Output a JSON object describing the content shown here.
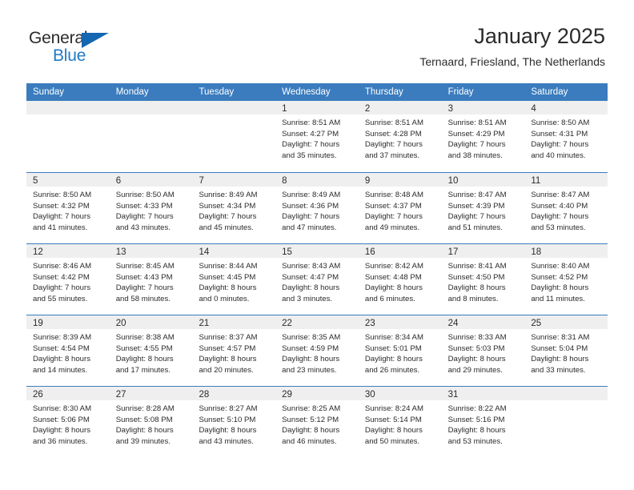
{
  "logo": {
    "word_top": "General",
    "word_bottom": "Blue",
    "triangle_color": "#1567b1",
    "blue_color": "#1f7ac4"
  },
  "header": {
    "title": "January 2025",
    "subtitle": "Ternaard, Friesland, The Netherlands"
  },
  "theme": {
    "header_blue": "#3a7cbe",
    "daynum_band": "#efefef",
    "text": "#2b2b2b"
  },
  "calendar": {
    "day_names": [
      "Sunday",
      "Monday",
      "Tuesday",
      "Wednesday",
      "Thursday",
      "Friday",
      "Saturday"
    ],
    "weeks": [
      [
        {
          "day": "",
          "lines": []
        },
        {
          "day": "",
          "lines": []
        },
        {
          "day": "",
          "lines": []
        },
        {
          "day": "1",
          "lines": [
            "Sunrise: 8:51 AM",
            "Sunset: 4:27 PM",
            "Daylight: 7 hours",
            "and 35 minutes."
          ]
        },
        {
          "day": "2",
          "lines": [
            "Sunrise: 8:51 AM",
            "Sunset: 4:28 PM",
            "Daylight: 7 hours",
            "and 37 minutes."
          ]
        },
        {
          "day": "3",
          "lines": [
            "Sunrise: 8:51 AM",
            "Sunset: 4:29 PM",
            "Daylight: 7 hours",
            "and 38 minutes."
          ]
        },
        {
          "day": "4",
          "lines": [
            "Sunrise: 8:50 AM",
            "Sunset: 4:31 PM",
            "Daylight: 7 hours",
            "and 40 minutes."
          ]
        }
      ],
      [
        {
          "day": "5",
          "lines": [
            "Sunrise: 8:50 AM",
            "Sunset: 4:32 PM",
            "Daylight: 7 hours",
            "and 41 minutes."
          ]
        },
        {
          "day": "6",
          "lines": [
            "Sunrise: 8:50 AM",
            "Sunset: 4:33 PM",
            "Daylight: 7 hours",
            "and 43 minutes."
          ]
        },
        {
          "day": "7",
          "lines": [
            "Sunrise: 8:49 AM",
            "Sunset: 4:34 PM",
            "Daylight: 7 hours",
            "and 45 minutes."
          ]
        },
        {
          "day": "8",
          "lines": [
            "Sunrise: 8:49 AM",
            "Sunset: 4:36 PM",
            "Daylight: 7 hours",
            "and 47 minutes."
          ]
        },
        {
          "day": "9",
          "lines": [
            "Sunrise: 8:48 AM",
            "Sunset: 4:37 PM",
            "Daylight: 7 hours",
            "and 49 minutes."
          ]
        },
        {
          "day": "10",
          "lines": [
            "Sunrise: 8:47 AM",
            "Sunset: 4:39 PM",
            "Daylight: 7 hours",
            "and 51 minutes."
          ]
        },
        {
          "day": "11",
          "lines": [
            "Sunrise: 8:47 AM",
            "Sunset: 4:40 PM",
            "Daylight: 7 hours",
            "and 53 minutes."
          ]
        }
      ],
      [
        {
          "day": "12",
          "lines": [
            "Sunrise: 8:46 AM",
            "Sunset: 4:42 PM",
            "Daylight: 7 hours",
            "and 55 minutes."
          ]
        },
        {
          "day": "13",
          "lines": [
            "Sunrise: 8:45 AM",
            "Sunset: 4:43 PM",
            "Daylight: 7 hours",
            "and 58 minutes."
          ]
        },
        {
          "day": "14",
          "lines": [
            "Sunrise: 8:44 AM",
            "Sunset: 4:45 PM",
            "Daylight: 8 hours",
            "and 0 minutes."
          ]
        },
        {
          "day": "15",
          "lines": [
            "Sunrise: 8:43 AM",
            "Sunset: 4:47 PM",
            "Daylight: 8 hours",
            "and 3 minutes."
          ]
        },
        {
          "day": "16",
          "lines": [
            "Sunrise: 8:42 AM",
            "Sunset: 4:48 PM",
            "Daylight: 8 hours",
            "and 6 minutes."
          ]
        },
        {
          "day": "17",
          "lines": [
            "Sunrise: 8:41 AM",
            "Sunset: 4:50 PM",
            "Daylight: 8 hours",
            "and 8 minutes."
          ]
        },
        {
          "day": "18",
          "lines": [
            "Sunrise: 8:40 AM",
            "Sunset: 4:52 PM",
            "Daylight: 8 hours",
            "and 11 minutes."
          ]
        }
      ],
      [
        {
          "day": "19",
          "lines": [
            "Sunrise: 8:39 AM",
            "Sunset: 4:54 PM",
            "Daylight: 8 hours",
            "and 14 minutes."
          ]
        },
        {
          "day": "20",
          "lines": [
            "Sunrise: 8:38 AM",
            "Sunset: 4:55 PM",
            "Daylight: 8 hours",
            "and 17 minutes."
          ]
        },
        {
          "day": "21",
          "lines": [
            "Sunrise: 8:37 AM",
            "Sunset: 4:57 PM",
            "Daylight: 8 hours",
            "and 20 minutes."
          ]
        },
        {
          "day": "22",
          "lines": [
            "Sunrise: 8:35 AM",
            "Sunset: 4:59 PM",
            "Daylight: 8 hours",
            "and 23 minutes."
          ]
        },
        {
          "day": "23",
          "lines": [
            "Sunrise: 8:34 AM",
            "Sunset: 5:01 PM",
            "Daylight: 8 hours",
            "and 26 minutes."
          ]
        },
        {
          "day": "24",
          "lines": [
            "Sunrise: 8:33 AM",
            "Sunset: 5:03 PM",
            "Daylight: 8 hours",
            "and 29 minutes."
          ]
        },
        {
          "day": "25",
          "lines": [
            "Sunrise: 8:31 AM",
            "Sunset: 5:04 PM",
            "Daylight: 8 hours",
            "and 33 minutes."
          ]
        }
      ],
      [
        {
          "day": "26",
          "lines": [
            "Sunrise: 8:30 AM",
            "Sunset: 5:06 PM",
            "Daylight: 8 hours",
            "and 36 minutes."
          ]
        },
        {
          "day": "27",
          "lines": [
            "Sunrise: 8:28 AM",
            "Sunset: 5:08 PM",
            "Daylight: 8 hours",
            "and 39 minutes."
          ]
        },
        {
          "day": "28",
          "lines": [
            "Sunrise: 8:27 AM",
            "Sunset: 5:10 PM",
            "Daylight: 8 hours",
            "and 43 minutes."
          ]
        },
        {
          "day": "29",
          "lines": [
            "Sunrise: 8:25 AM",
            "Sunset: 5:12 PM",
            "Daylight: 8 hours",
            "and 46 minutes."
          ]
        },
        {
          "day": "30",
          "lines": [
            "Sunrise: 8:24 AM",
            "Sunset: 5:14 PM",
            "Daylight: 8 hours",
            "and 50 minutes."
          ]
        },
        {
          "day": "31",
          "lines": [
            "Sunrise: 8:22 AM",
            "Sunset: 5:16 PM",
            "Daylight: 8 hours",
            "and 53 minutes."
          ]
        },
        {
          "day": "",
          "lines": []
        }
      ]
    ]
  }
}
